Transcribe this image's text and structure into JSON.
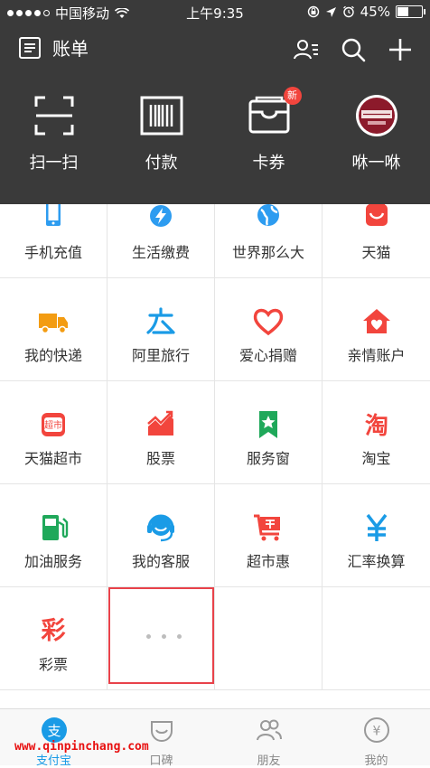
{
  "status_bar": {
    "carrier": "中国移动",
    "time": "上午9:35",
    "battery": "45%",
    "battery_level": 0.45
  },
  "header": {
    "bill_label": "账单",
    "icons": [
      "contacts-icon",
      "search-icon",
      "plus-icon"
    ]
  },
  "quick_actions": [
    {
      "label": "扫一扫",
      "icon": "scan-icon"
    },
    {
      "label": "付款",
      "icon": "barcode-icon"
    },
    {
      "label": "卡券",
      "icon": "card-wallet-icon",
      "badge": "新"
    },
    {
      "label": "咻一咻",
      "icon": "haagen-dazs-logo-icon"
    }
  ],
  "services": [
    {
      "label": "手机充值",
      "icon": "phone-icon",
      "color": "#2d9cf0"
    },
    {
      "label": "生活缴费",
      "icon": "lightning-icon",
      "color": "#2d9cf0"
    },
    {
      "label": "世界那么大",
      "icon": "globe-icon",
      "color": "#2d9cf0"
    },
    {
      "label": "天猫",
      "icon": "tmall-icon",
      "color": "#f2453d"
    },
    {
      "label": "我的快递",
      "icon": "truck-icon",
      "color": "#f39c12"
    },
    {
      "label": "阿里旅行",
      "icon": "travel-icon",
      "color": "#1a9be6"
    },
    {
      "label": "爱心捐赠",
      "icon": "heart-icon",
      "color": "#f2453d"
    },
    {
      "label": "亲情账户",
      "icon": "home-heart-icon",
      "color": "#f2453d"
    },
    {
      "label": "天猫超市",
      "icon": "supermarket-icon",
      "color": "#f2453d"
    },
    {
      "label": "股票",
      "icon": "stock-chart-icon",
      "color": "#f2453d"
    },
    {
      "label": "服务窗",
      "icon": "bookmark-star-icon",
      "color": "#1fa85a"
    },
    {
      "label": "淘宝",
      "icon": "taobao-icon",
      "color": "#f2453d"
    },
    {
      "label": "加油服务",
      "icon": "gas-pump-icon",
      "color": "#1fa85a"
    },
    {
      "label": "我的客服",
      "icon": "headset-icon",
      "color": "#1a9be6"
    },
    {
      "label": "超市惠",
      "icon": "cart-icon",
      "color": "#f2453d"
    },
    {
      "label": "汇率换算",
      "icon": "yen-icon",
      "color": "#1a9be6"
    },
    {
      "label": "彩票",
      "icon": "lottery-icon",
      "color": "#f2453d",
      "glyph": "彩"
    }
  ],
  "quick_glyph_tmall_text": "超市",
  "taobao_glyph": "淘",
  "tabs": [
    {
      "label": "支付宝",
      "icon": "alipay-icon",
      "active": true,
      "glyph": "支"
    },
    {
      "label": "口碑",
      "icon": "koubei-icon",
      "active": false
    },
    {
      "label": "朋友",
      "icon": "friends-icon",
      "active": false
    },
    {
      "label": "我的",
      "icon": "wallet-yen-icon",
      "active": false,
      "glyph": "¥"
    }
  ],
  "watermark": "www.qinpinchang.com",
  "colors": {
    "header_bg": "#3a3a3a",
    "accent_blue": "#1a9be6",
    "highlight_red": "#e8424a"
  }
}
